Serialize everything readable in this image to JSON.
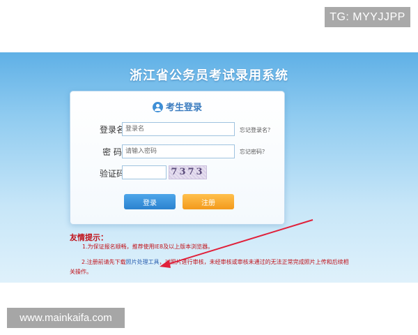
{
  "watermarks": {
    "telegram": "TG: MYYJJPP",
    "website": "www.mainkaifa.com"
  },
  "system": {
    "title": "浙江省公务员考试录用系统"
  },
  "login": {
    "heading": "考生登录",
    "username_label": "登录名",
    "username_placeholder": "登录名",
    "forgot_username": "忘记登录名？",
    "password_label": "密 码",
    "password_placeholder": "请输入密码",
    "forgot_password": "忘记密码？",
    "captcha_label": "验证码",
    "captcha_value": "",
    "captcha_text": "7373",
    "login_button": "登录",
    "register_button": "注册"
  },
  "tips": {
    "title": "友情提示：",
    "tip1": "1.为保证报名顺畅，推荐使用IE8及以上版本浏览器。",
    "tip2_prefix": "2.注册前请先下载",
    "tip2_link": "照片处理工具",
    "tip2_suffix": "，对照片进行审核，未经审核或审核未通过的无法正常完成照片上传和后续相",
    "tip2_line2": "关操作。"
  },
  "colors": {
    "annotation_arrow": "#e0203a",
    "tips_text": "#c0121a",
    "login_button": "#2b82cf",
    "register_button": "#f39a1c"
  }
}
